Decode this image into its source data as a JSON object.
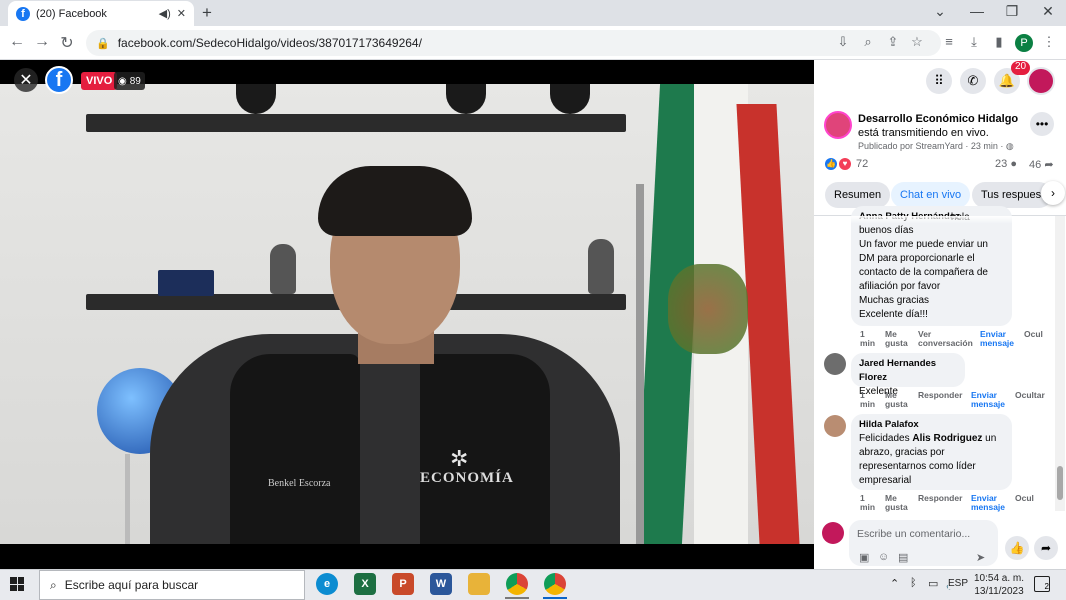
{
  "browser": {
    "tab_title": "(20) Facebook",
    "url": "facebook.com/SedecoHidalgo/videos/387017173649264/",
    "profile_letter": "P"
  },
  "video": {
    "live_label": "VIVO",
    "viewer_count": "89",
    "vest_text": "ECONOMÍA",
    "vest_name": "Benkel Escorza"
  },
  "header": {
    "notification_count": "20"
  },
  "post": {
    "page_name": "Desarrollo Económico Hidalgo",
    "status": "está transmitiendo en vivo.",
    "meta": "Publicado por StreamYard · 23 min ·",
    "reaction_count": "72",
    "comment_count": "23",
    "share_count": "46"
  },
  "tabs": {
    "summary": "Resumen",
    "live_chat": "Chat en vivo",
    "yours": "Tus respuestas"
  },
  "comments": [
    {
      "author": "Anna Patty Hernández",
      "lines": [
        "hola",
        "buenos días",
        "Un favor me puede enviar un",
        "DM para proporcionarle el",
        "contacto de la compañera de",
        "afiliación por favor",
        "Muchas gracias",
        "Excelente día!!!"
      ],
      "time": [
        "1",
        "min"
      ],
      "like": [
        "Me",
        "gusta"
      ],
      "reply": [
        "Ver",
        "conversación"
      ],
      "message": [
        "Enviar",
        "mensaje"
      ],
      "hide": "Ocul"
    },
    {
      "author": "Jared Hernandes Florez",
      "lines": [
        "Exelente"
      ],
      "time": [
        "1",
        "min"
      ],
      "like": [
        "Me",
        "gusta"
      ],
      "reply": [
        "Responder"
      ],
      "message": [
        "Enviar",
        "mensaje"
      ],
      "hide": "Ocultar"
    },
    {
      "author": "Hilda Palafox",
      "mention": "Alis Rodriguez",
      "lines": [
        "Felicidades",
        "un",
        "abrazo, gracias por",
        "representarnos como líder",
        "empresarial"
      ],
      "time": [
        "1",
        "min"
      ],
      "like": [
        "Me",
        "gusta"
      ],
      "reply": [
        "Responder"
      ],
      "message": [
        "Enviar",
        "mensaje"
      ],
      "hide": "Ocul"
    }
  ],
  "composer": {
    "placeholder": "Escribe un comentario..."
  },
  "taskbar": {
    "search_placeholder": "Escribe aquí para buscar",
    "language": "ESP",
    "time": "10:54 a. m.",
    "date": "13/11/2023",
    "notification_count": "2"
  },
  "colors": {
    "facebook_blue": "#1877f2",
    "live_red": "#e41e3f"
  }
}
